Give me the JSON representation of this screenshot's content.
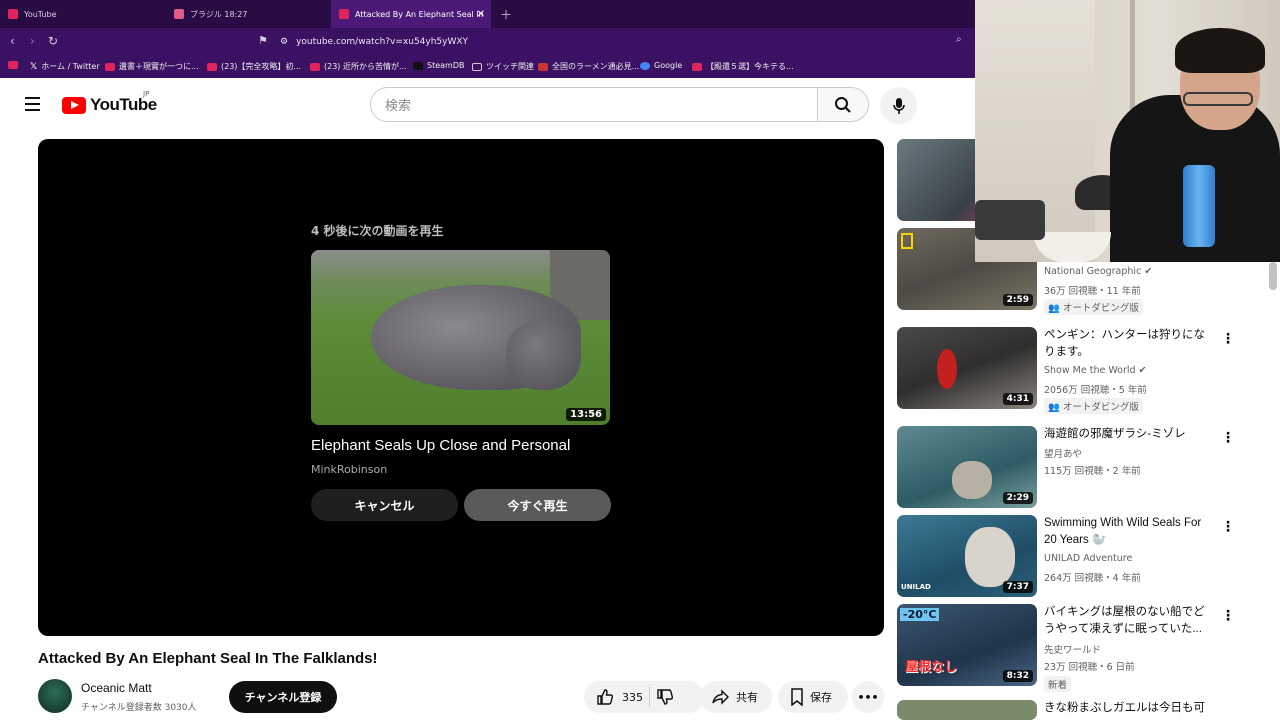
{
  "browser": {
    "tabs": [
      {
        "label": "YouTube"
      },
      {
        "label": "ブラジル 18:27"
      },
      {
        "label": "Attacked By An Elephant Seal In"
      }
    ],
    "url": "youtube.com/watch?v=xu54yh5yWXY",
    "bookmarks": [
      "ホーム / Twitter",
      "遺書＋現實が一つに...",
      "(23)【完全攻略】初...",
      "(23) 近所から苦情が...",
      "SteamDB",
      "ツイッチ関連",
      "全国のラーメン通必見...",
      "Google",
      "【殿還５選】今キテる..."
    ]
  },
  "header": {
    "logo_text": "YouTube",
    "region": "JP",
    "search_placeholder": "検索"
  },
  "player": {
    "upnext_label": "4 秒後に次の動画を再生",
    "upnext_title": "Elephant Seals Up Close and Personal",
    "upnext_channel": "MinkRobinson",
    "upnext_duration": "13:56",
    "cancel_label": "キャンセル",
    "play_now_label": "今すぐ再生"
  },
  "video": {
    "title": "Attacked By An Elephant Seal In The Falklands!",
    "channel": "Oceanic Matt",
    "subscribers": "チャンネル登録者数 3030人",
    "subscribe_label": "チャンネル登録",
    "likes": "335",
    "share_label": "共有",
    "save_label": "保存"
  },
  "sidebar": [
    {
      "title": "",
      "channel": "National Geographic",
      "meta": "36万 回視聴・11 年前",
      "badge": "オートダビング版",
      "duration": "2:59"
    },
    {
      "title": "ペンギン：ハンターは狩りになります。",
      "channel": "Show Me the World",
      "meta": "2056万 回視聴・5 年前",
      "badge": "オートダビング版",
      "duration": "4:31"
    },
    {
      "title": "海遊館の邪魔ザラシ-ミゾレ",
      "channel": "望月あや",
      "meta": "115万 回視聴・2 年前",
      "badge": "",
      "duration": "2:29"
    },
    {
      "title": "Swimming With Wild Seals For 20 Years 🦭",
      "channel": "UNILAD Adventure",
      "meta": "264万 回視聴・4 年前",
      "badge": "",
      "duration": "7:37"
    },
    {
      "title": "バイキングは屋根のない船でどうやって凍えずに眠っていた...",
      "channel": "先史ワールド",
      "meta": "23万 回視聴・6 日前",
      "badge": "新着",
      "duration": "8:32"
    },
    {
      "title": "きな粉まぶしガエルは今日も可",
      "channel": "",
      "meta": "",
      "badge": "",
      "duration": ""
    }
  ],
  "thumb_text": {
    "temp": "-20°C",
    "roof": "屋根なし",
    "unilad": "UNILAD"
  }
}
